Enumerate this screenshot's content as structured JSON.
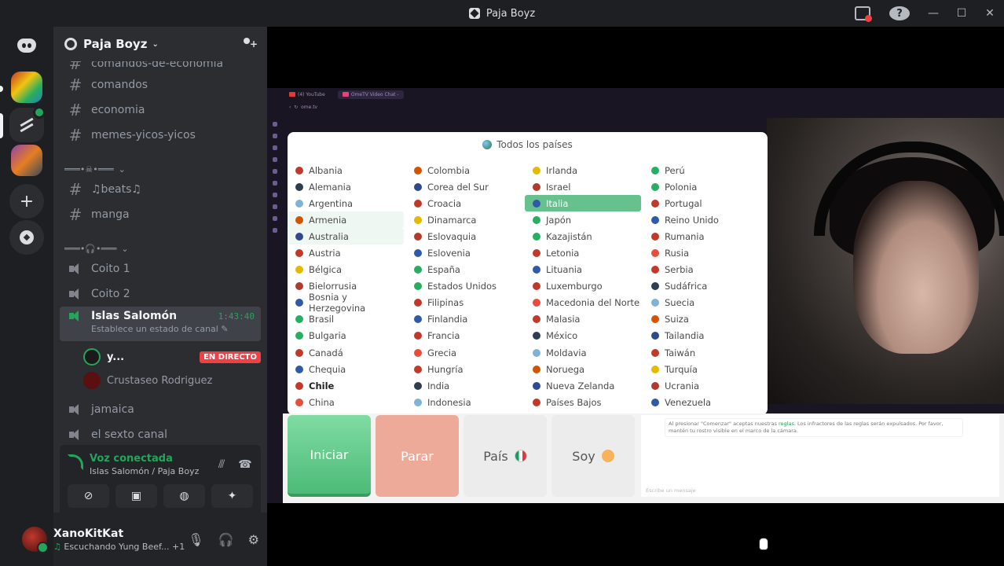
{
  "window": {
    "title": "Paja Boyz"
  },
  "guild": {
    "name": "Paja Boyz"
  },
  "channels": {
    "text_top": [
      "comandos-de-economia",
      "comandos",
      "economia",
      "memes-yicos-yicos"
    ],
    "category1": "═══•☠•═══",
    "text_mid": [
      "♫beats♫",
      "manga"
    ],
    "category2": "═══•🎧•═══",
    "voice": [
      "Coito 1",
      "Coito 2"
    ],
    "active": {
      "name": "Islas Salomón",
      "timer": "1:43:40",
      "status": "Establece un estado de canal"
    },
    "voice_users": [
      {
        "name": "y...",
        "badge": "EN DIRECTO"
      },
      {
        "name": "Crustaseo Rodriguez"
      }
    ],
    "voice_bottom": [
      "jamaica",
      "el sexto canal"
    ]
  },
  "voice_panel": {
    "title": "Voz conectada",
    "subtitle": "Islas Salomón / Paja Boyz"
  },
  "user": {
    "name": "XanoKitKat",
    "activity": "Escuchando Yung Beef...",
    "extra": "+1"
  },
  "stream": {
    "browser_tabs": [
      "(4) YouTube",
      "OmeTV Video Chat -"
    ],
    "address": "ome.tv",
    "country_title": "Todos los países",
    "countries": [
      [
        "Albania",
        "Alemania",
        "Argentina",
        "Armenia",
        "Australia",
        "Austria",
        "Bélgica",
        "Bielorrusia",
        "Bosnia y Herzegovina",
        "Brasil",
        "Bulgaria",
        "Canadá",
        "Chequia",
        "Chile",
        "China"
      ],
      [
        "Colombia",
        "Corea del Sur",
        "Croacia",
        "Dinamarca",
        "Eslovaquia",
        "Eslovenia",
        "España",
        "Estados Unidos",
        "Filipinas",
        "Finlandia",
        "Francia",
        "Grecia",
        "Hungría",
        "India",
        "Indonesia"
      ],
      [
        "Irlanda",
        "Israel",
        "Italia",
        "Japón",
        "Kazajistán",
        "Letonia",
        "Lituania",
        "Luxemburgo",
        "Macedonia del Norte",
        "Malasia",
        "México",
        "Moldavia",
        "Noruega",
        "Nueva Zelanda",
        "Países Bajos"
      ],
      [
        "Perú",
        "Polonia",
        "Portugal",
        "Reino Unido",
        "Rumania",
        "Rusia",
        "Serbia",
        "Sudáfrica",
        "Suecia",
        "Suiza",
        "Tailandia",
        "Taiwán",
        "Turquía",
        "Ucrania",
        "Venezuela"
      ]
    ],
    "selected_country": "Italia",
    "buttons": {
      "start": "Iniciar",
      "stop": "Parar",
      "country": "País",
      "soy": "Soy"
    },
    "chat_rules_a": "Al presionar \"Comenzar\" aceptas nuestras ",
    "chat_rules_link": "reglas",
    "chat_rules_b": ". Los infractores de las reglas serán expulsados. Por favor, mantén tu rostro visible en el marco de la cámara.",
    "chat_placeholder": "Escribe un mensaje"
  },
  "colors": {
    "accent_green": "#23a55a",
    "live_red": "#ed4245",
    "ome_green": "#67c18c"
  }
}
